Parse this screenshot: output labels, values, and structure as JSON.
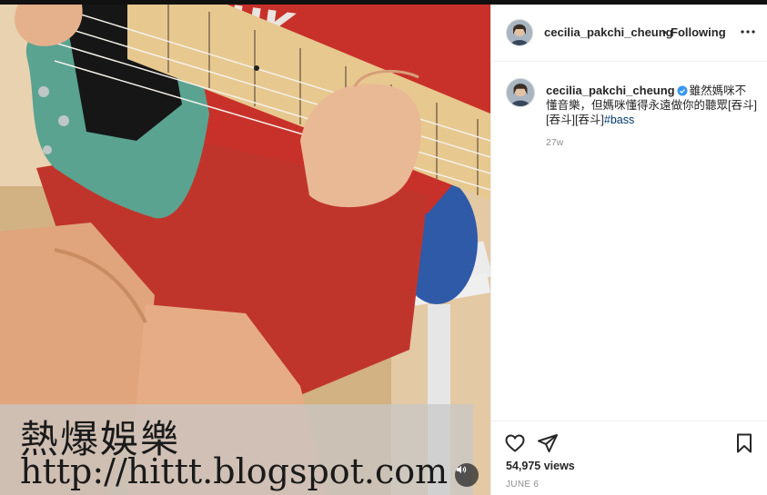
{
  "post": {
    "username": "cecilia_pakchi_cheung",
    "follow_status": "Following",
    "separator": "•",
    "caption": "雖然媽咪不懂音樂，但媽咪懂得永遠做你的聽眾[吞斗][吞斗][吞斗]",
    "hashtag": "#bass",
    "time_ago": "27w",
    "views": "54,975 views",
    "date": "JUNE 6"
  },
  "watermark": {
    "line1": "熱爆娛樂",
    "line2": "http://hittt.blogspot.com"
  },
  "icons": {
    "avatar": "profile-avatar",
    "verified": "verified-badge-icon",
    "more": "more-options-icon",
    "like": "heart-icon",
    "share": "send-icon",
    "save": "bookmark-icon",
    "mute": "speaker-icon"
  },
  "colors": {
    "verified": "#3897f0",
    "hashtag": "#00376b",
    "secondary_text": "#8e8e8e"
  }
}
